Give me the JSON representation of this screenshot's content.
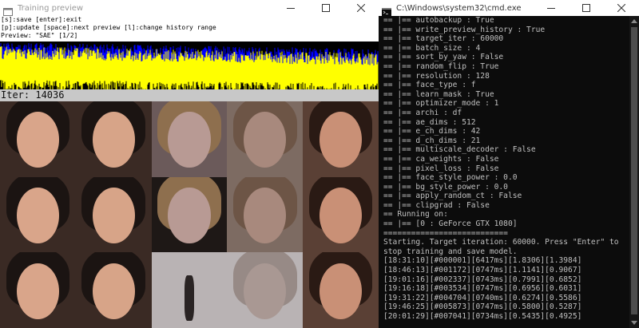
{
  "preview_window": {
    "title": "Training preview",
    "hints": [
      "[s]:save [enter]:exit",
      "[p]:update [space]:next preview [l]:change history range",
      "Preview: \"SAE\" [1/2]"
    ],
    "iteration": "Iter: 14036",
    "colors": {
      "graph_bg": "#000000",
      "series_a": "#ffff00",
      "series_b": "#0000ff",
      "iter_bar": "#c8c8c8"
    },
    "preview_rows": [
      {
        "cells": [
          "source-face",
          "source-reconstruction",
          "destination-face",
          "destination-reconstruction",
          "swapped-result"
        ]
      },
      {
        "cells": [
          "source-face",
          "source-reconstruction",
          "destination-face",
          "destination-reconstruction",
          "swapped-result"
        ]
      },
      {
        "cells": [
          "source-face",
          "source-reconstruction",
          "destination-face",
          "destination-reconstruction",
          "swapped-result"
        ]
      }
    ]
  },
  "cmd_window": {
    "title": "C:\\Windows\\system32\\cmd.exe",
    "lines": [
      "== |== autobackup : True",
      "== |== write_preview_history : True",
      "== |== target_iter : 60000",
      "== |== batch_size : 4",
      "== |== sort_by_yaw : False",
      "== |== random_flip : True",
      "== |== resolution : 128",
      "== |== face_type : f",
      "== |== learn_mask : True",
      "== |== optimizer_mode : 1",
      "== |== archi : df",
      "== |== ae_dims : 512",
      "== |== e_ch_dims : 42",
      "== |== d_ch_dims : 21",
      "== |== multiscale_decoder : False",
      "== |== ca_weights : False",
      "== |== pixel_loss : False",
      "== |== face_style_power : 0.0",
      "== |== bg_style_power : 0.0",
      "== |== apply_random_ct : False",
      "== |== clipgrad : False",
      "== Running on:",
      "== |== [0 : GeForce GTX 1080]",
      "===========================",
      "Starting. Target iteration: 60000. Press \"Enter\" to",
      "stop training and save model.",
      "[18:31:10][#000001][6417ms][1.8306][1.3984]",
      "[18:46:13][#001172][0747ms][1.1141][0.9067]",
      "[19:01:16][#002337][0743ms][0.7991][0.6852]",
      "[19:16:18][#003534][0747ms][0.6956][0.6031]",
      "[19:31:22][#004704][0740ms][0.6274][0.5586]",
      "[19:46:25][#005873][0747ms][0.5800][0.5287]",
      "[20:01:29][#007041][0734ms][0.5435][0.4925]"
    ]
  }
}
